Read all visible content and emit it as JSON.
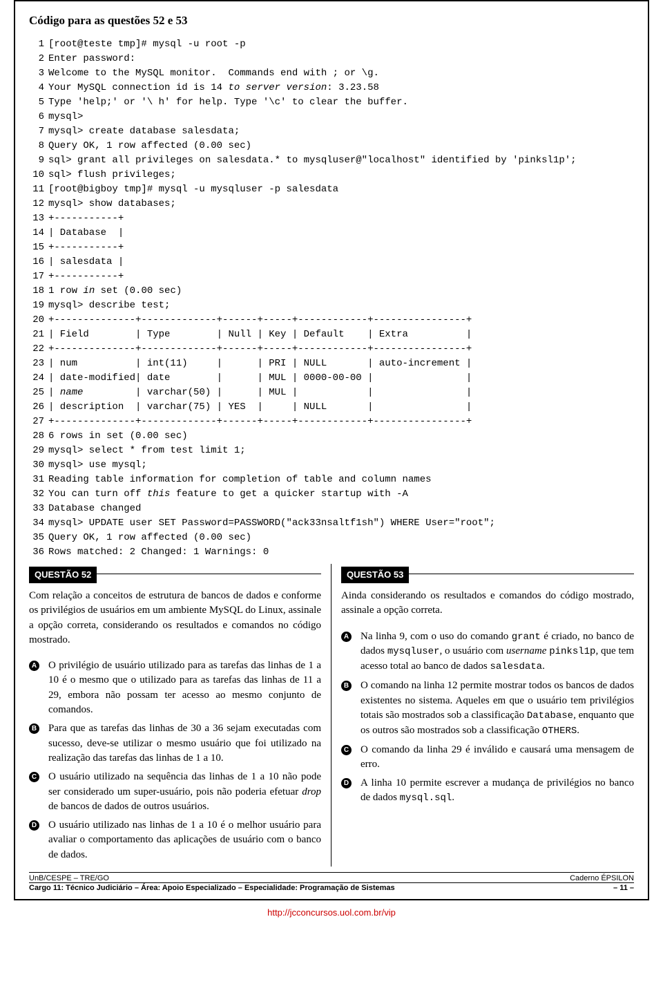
{
  "header": {
    "title": "Código para as questões 52 e 53"
  },
  "code": {
    "lines": [
      {
        "n": "1",
        "t": "[root@teste tmp]# mysql -u root -p"
      },
      {
        "n": "2",
        "t": "Enter password:"
      },
      {
        "n": "3",
        "t": "Welcome to the MySQL monitor.  Commands end with ; or \\g."
      },
      {
        "n": "4",
        "t": "Your MySQL connection id is 14 <i>to server version</i>: 3.23.58"
      },
      {
        "n": "5",
        "t": "Type 'help;' or '\\ h' for help. Type '\\c' to clear the buffer."
      },
      {
        "n": "6",
        "t": "mysql>"
      },
      {
        "n": "7",
        "t": "mysql> create database salesdata;"
      },
      {
        "n": "8",
        "t": "Query OK, 1 row affected (0.00 sec)"
      },
      {
        "n": "9",
        "t": "sql> grant all privileges on salesdata.* to mysqluser@\"localhost\" identified by 'pinksl1p';"
      },
      {
        "n": "10",
        "t": "sql> flush privileges;"
      },
      {
        "n": "11",
        "t": "[root@bigboy tmp]# mysql -u mysqluser -p salesdata"
      },
      {
        "n": "12",
        "t": "mysql> show databases;"
      },
      {
        "n": "13",
        "t": "+-----------+"
      },
      {
        "n": "14",
        "t": "| Database  |"
      },
      {
        "n": "15",
        "t": "+-----------+"
      },
      {
        "n": "16",
        "t": "| salesdata |"
      },
      {
        "n": "17",
        "t": "+-----------+"
      },
      {
        "n": "18",
        "t": "1 row <i>in</i> set (0.00 sec)"
      },
      {
        "n": "19",
        "t": "mysql> describe test;"
      },
      {
        "n": "20",
        "t": "+--------------+-------------+------+-----+------------+----------------+"
      },
      {
        "n": "21",
        "t": "| Field        | Type        | Null | Key | Default    | Extra          |"
      },
      {
        "n": "22",
        "t": "+--------------+-------------+------+-----+------------+----------------+"
      },
      {
        "n": "23",
        "t": "| num          | int(11)     |      | PRI | NULL       | auto-increment |"
      },
      {
        "n": "24",
        "t": "| date-modified| date        |      | MUL | 0000-00-00 |                |"
      },
      {
        "n": "25",
        "t": "| <i>name</i>         | varchar(50) |      | MUL |            |                |"
      },
      {
        "n": "26",
        "t": "| description  | varchar(75) | YES  |     | NULL       |                |"
      },
      {
        "n": "27",
        "t": "+--------------+-------------+------+-----+------------+----------------+"
      },
      {
        "n": "28",
        "t": "6 rows in set (0.00 sec)"
      },
      {
        "n": "29",
        "t": "mysql> select * from test limit 1;"
      },
      {
        "n": "30",
        "t": "mysql> use mysql;"
      },
      {
        "n": "31",
        "t": "Reading table information for completion of table and column names"
      },
      {
        "n": "32",
        "t": "You can turn off <i>this</i> feature to get a quicker startup with -A"
      },
      {
        "n": "33",
        "t": "Database changed"
      },
      {
        "n": "34",
        "t": "mysql> UPDATE user SET Password=PASSWORD(\"ack33nsaltf1sh\") WHERE User=\"root\";"
      },
      {
        "n": "35",
        "t": "Query OK, 1 row affected (0.00 sec)"
      },
      {
        "n": "36",
        "t": "Rows matched: 2 Changed: 1 Warnings: 0"
      }
    ]
  },
  "q52": {
    "label": "QUESTÃO 52",
    "stem": "Com relação a conceitos de estrutura de bancos de dados e conforme os privilégios de usuários em um ambiente MySQL do Linux, assinale a opção correta, considerando os resultados e comandos no código mostrado.",
    "options": {
      "A": "O privilégio de usuário utilizado para as tarefas das linhas de 1 a 10 é o mesmo que o utilizado para as tarefas das linhas de 11 a 29, embora não possam ter acesso ao mesmo conjunto de comandos.",
      "B": "Para que as tarefas das linhas de 30 a 36 sejam executadas com sucesso, deve-se utilizar o mesmo usuário que foi utilizado na realização das tarefas das linhas de 1 a 10.",
      "C": "O usuário utilizado na sequência das linhas de 1 a 10 não pode ser considerado um super-usuário, pois não poderia efetuar <i>drop</i> de bancos de dados de outros usuários.",
      "D": "O usuário utilizado nas linhas de 1 a 10 é o melhor usuário para avaliar o comportamento das aplicações de usuário com o banco de dados."
    }
  },
  "q53": {
    "label": "QUESTÃO 53",
    "stem": "Ainda considerando os resultados e comandos do código mostrado, assinale a opção correta.",
    "options": {
      "A": "Na linha 9, com o uso do comando <span class=\"mono-inline\">grant</span> é criado, no banco de dados <span class=\"mono-inline\">mysqluser</span>, o usuário com <i>username</i> <span class=\"mono-inline\">pinksl1p</span>, que tem acesso total ao banco de dados <span class=\"mono-inline\">salesdata</span>.",
      "B": "O comando na linha 12 permite mostrar todos os bancos de dados existentes no sistema. Aqueles em que o usuário tem privilégios totais são mostrados sob a classificação <span class=\"mono-inline\">Database</span>, enquanto que os outros são mostrados sob a classificação <span class=\"mono-inline\">OTHERS</span>.",
      "C": "O comando da linha 29 é inválido e causará uma mensagem de erro.",
      "D": "A linha 10 permite escrever a mudança de privilégios no banco de dados <span class=\"mono-inline\">mysql.sql</span>."
    }
  },
  "footer": {
    "left1": "UnB/CESPE – TRE/GO",
    "right1": "Caderno ÉPSILON",
    "left2": "Cargo 11: Técnico Judiciário – Área: Apoio Especializado – Especialidade: Programação de Sistemas",
    "right2": "– 11 –"
  },
  "url": "http://jcconcursos.uol.com.br/vip"
}
